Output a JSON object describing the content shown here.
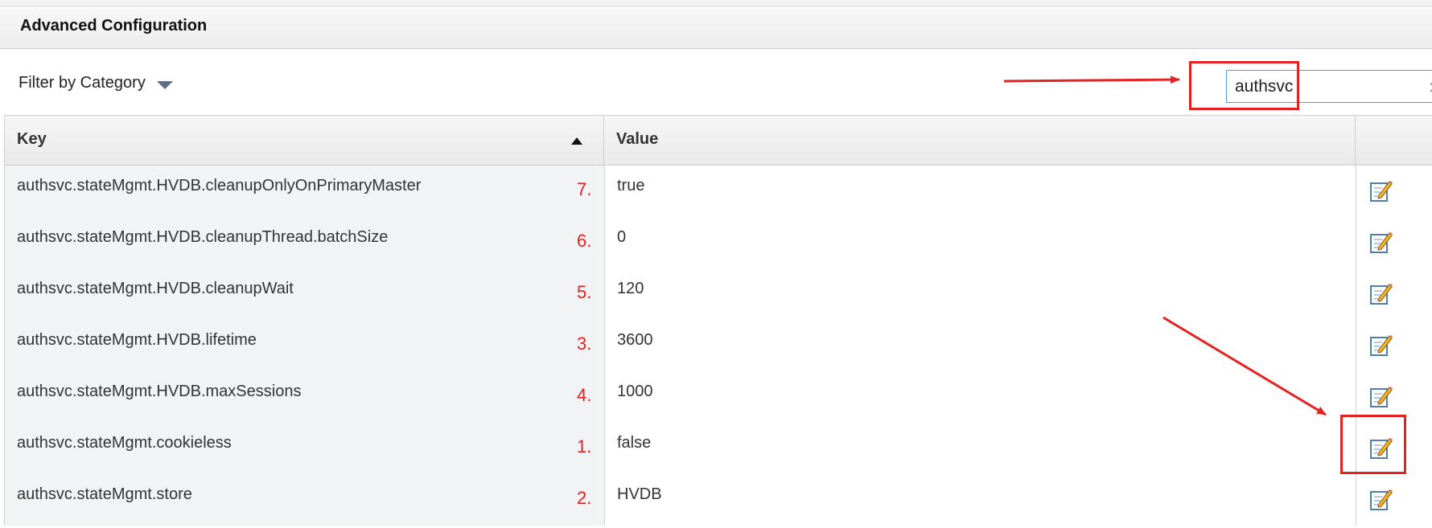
{
  "header": {
    "title": "Advanced Configuration"
  },
  "filter": {
    "label": "Filter by Category",
    "icon": "caret-down-icon"
  },
  "search": {
    "value": "authsvc",
    "clear_icon": "clear-icon"
  },
  "table": {
    "columns": {
      "key": "Key",
      "value": "Value"
    },
    "sort": "ascending",
    "rows": [
      {
        "key": "authsvc.stateMgmt.HVDB.cleanupOnlyOnPrimaryMaster",
        "value": "true",
        "annotation": "7."
      },
      {
        "key": "authsvc.stateMgmt.HVDB.cleanupThread.batchSize",
        "value": "0",
        "annotation": "6."
      },
      {
        "key": "authsvc.stateMgmt.HVDB.cleanupWait",
        "value": "120",
        "annotation": "5."
      },
      {
        "key": "authsvc.stateMgmt.HVDB.lifetime",
        "value": "3600",
        "annotation": "3."
      },
      {
        "key": "authsvc.stateMgmt.HVDB.maxSessions",
        "value": "1000",
        "annotation": "4."
      },
      {
        "key": "authsvc.stateMgmt.cookieless",
        "value": "false",
        "annotation": "1."
      },
      {
        "key": "authsvc.stateMgmt.store",
        "value": "HVDB",
        "annotation": "2."
      }
    ]
  },
  "colors": {
    "annotation": "#e32222",
    "search_border": "#4a9fd8",
    "caret": "#5a6f8c"
  }
}
